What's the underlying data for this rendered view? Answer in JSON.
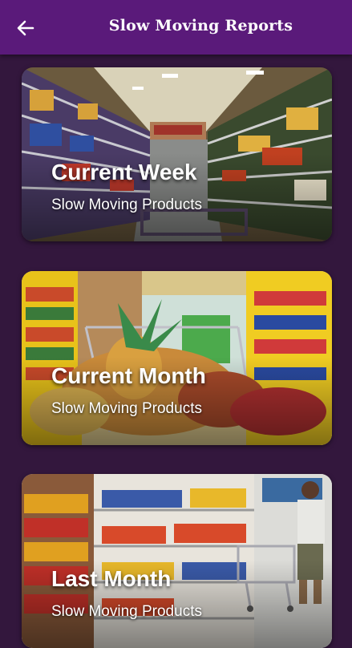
{
  "appbar": {
    "title": "Slow Moving Reports",
    "back_icon": "arrow-left-icon",
    "background": "#5a1a7a"
  },
  "page": {
    "background": "#33173d"
  },
  "reports": [
    {
      "heading": "Current Week",
      "subtitle": "Slow Moving Products",
      "image": "supermarket-aisle-image"
    },
    {
      "heading": "Current Month",
      "subtitle": "Slow Moving Products",
      "image": "shopping-cart-produce-image"
    },
    {
      "heading": "Last Month",
      "subtitle": "Slow Moving Products",
      "image": "grocery-shelves-shopper-image"
    }
  ]
}
